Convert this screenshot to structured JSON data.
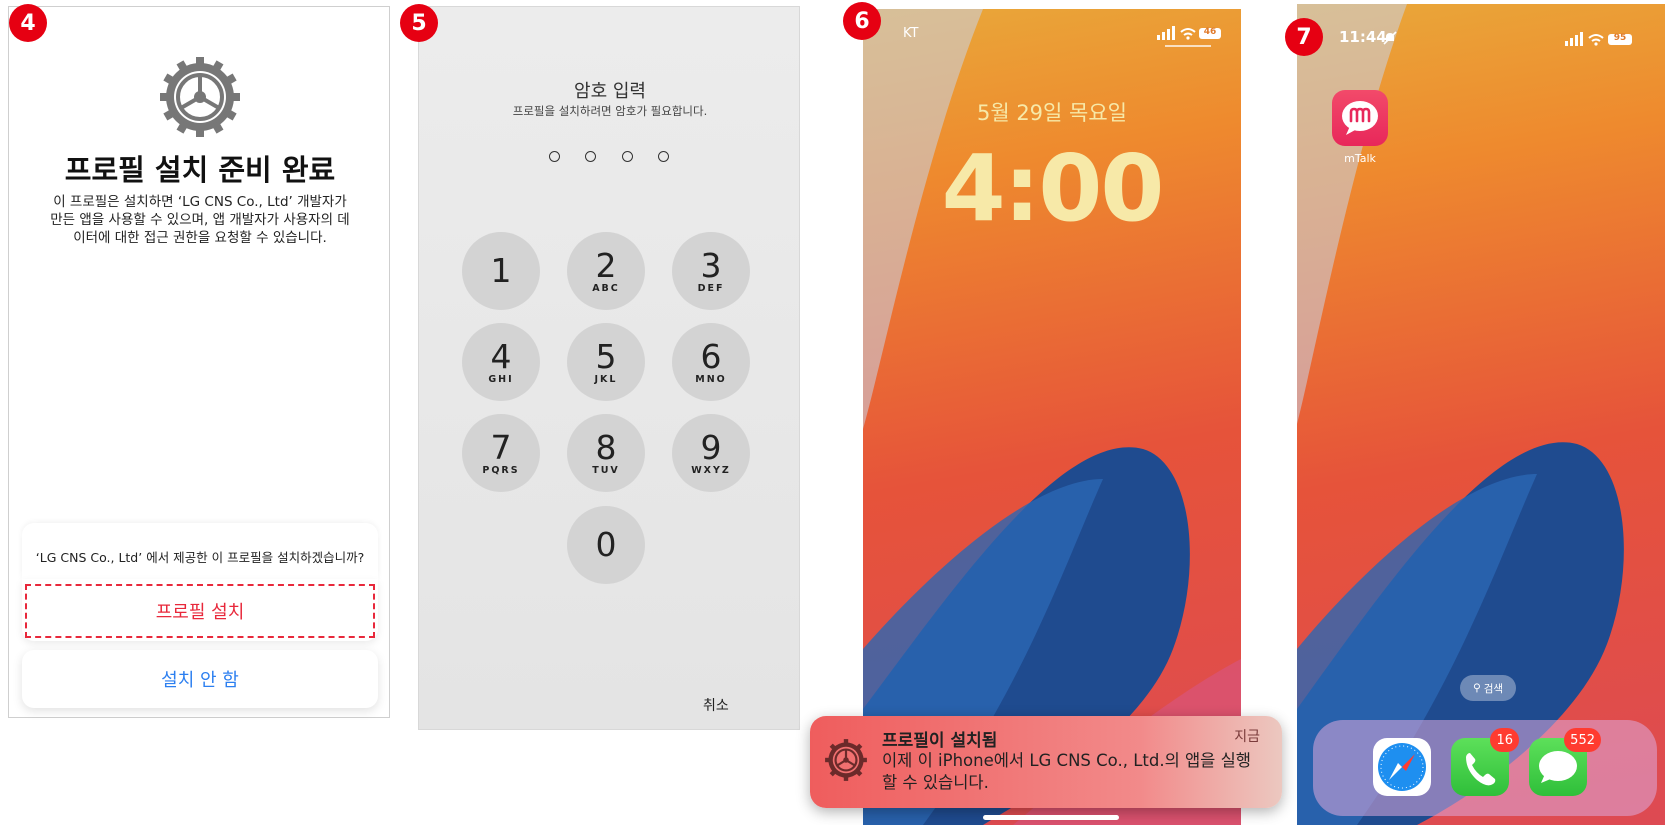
{
  "steps": {
    "s4": "4",
    "s5": "5",
    "s6": "6",
    "s7": "7"
  },
  "screen4": {
    "title": "프로필 설치 준비 완료",
    "desc": "이 프로필은 설치하면 ‘LG CNS Co., Ltd’ 개발자가 만든 앱을 사용할 수 있으며, 앱 개발자가 사용자의 데이터에 대한 접근 권한을 요청할 수 있습니다.",
    "question": "‘LG CNS Co., Ltd’ 에서 제공한 이 프로필을 설치하겠습니까?",
    "install_label": "프로필 설치",
    "cancel_label": "설치 안 함"
  },
  "screen5": {
    "title": "암호 입력",
    "subtitle": "프로필을 설치하려면 암호가 필요합니다.",
    "keys": [
      {
        "n": "1",
        "l": ""
      },
      {
        "n": "2",
        "l": "ABC"
      },
      {
        "n": "3",
        "l": "DEF"
      },
      {
        "n": "4",
        "l": "GHI"
      },
      {
        "n": "5",
        "l": "JKL"
      },
      {
        "n": "6",
        "l": "MNO"
      },
      {
        "n": "7",
        "l": "PQRS"
      },
      {
        "n": "8",
        "l": "TUV"
      },
      {
        "n": "9",
        "l": "WXYZ"
      },
      {
        "n": "0",
        "l": ""
      }
    ],
    "cancel_label": "취소"
  },
  "screen6": {
    "carrier": "KT",
    "battery": "46",
    "date": "5월 29일 목요일",
    "time": "4:00",
    "notification": {
      "title": "프로필이 설치됨",
      "time": "지금",
      "body": "이제 이 iPhone에서 LG CNS Co., Ltd.의 앱을 실행할 수 있습니다."
    }
  },
  "screen7": {
    "time": "11:44",
    "battery": "95",
    "app_label": "mTalk",
    "search_label": "검색",
    "phone_badge": "16",
    "messages_badge": "552"
  },
  "colors": {
    "step_red": "#e60012",
    "install_red": "#e8283b",
    "ios_blue": "#2c7ff0"
  }
}
